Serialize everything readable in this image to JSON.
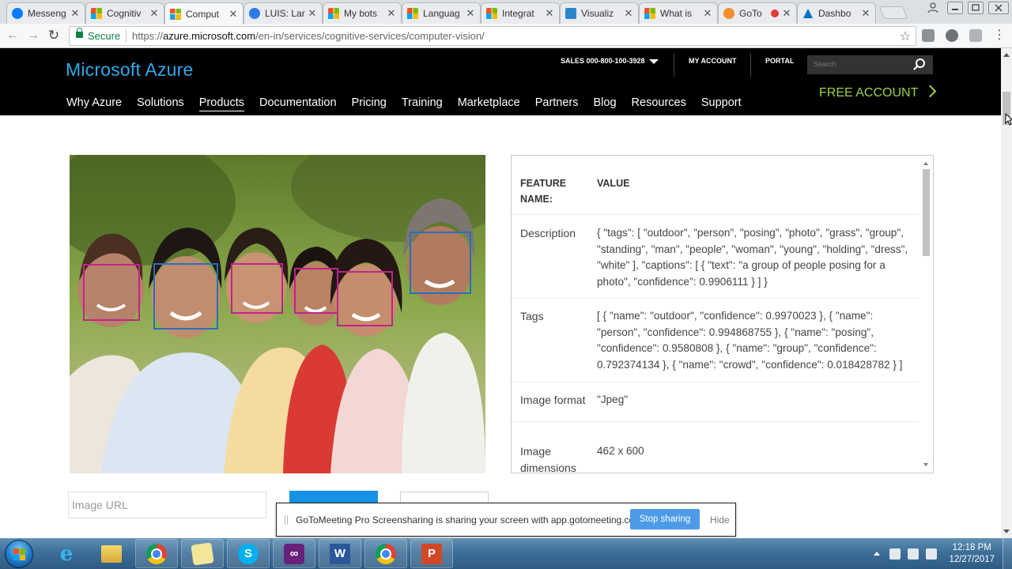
{
  "browser": {
    "tabs": [
      {
        "label": "Messeng",
        "icon": "messenger-icon"
      },
      {
        "label": "Cognitiv",
        "icon": "microsoft-icon"
      },
      {
        "label": "Comput",
        "icon": "microsoft-icon",
        "active": true
      },
      {
        "label": "LUIS: Lar",
        "icon": "luis-icon"
      },
      {
        "label": "My bots",
        "icon": "microsoft-icon"
      },
      {
        "label": "Languag",
        "icon": "microsoft-icon"
      },
      {
        "label": "Integrat",
        "icon": "microsoft-icon"
      },
      {
        "label": "Visualiz",
        "icon": "visualize-icon"
      },
      {
        "label": "What is",
        "icon": "microsoft-icon"
      },
      {
        "label": "GoTo",
        "icon": "gotomeeting-icon",
        "recording": true
      },
      {
        "label": "Dashbo",
        "icon": "azure-icon"
      }
    ],
    "secure_label": "Secure",
    "url_scheme": "https://",
    "url_domain": "azure.microsoft.com",
    "url_path": "/en-in/services/cognitive-services/computer-vision/"
  },
  "azure": {
    "brand": "Microsoft Azure",
    "sales": "SALES 000-800-100-3928",
    "my_account": "MY ACCOUNT",
    "portal": "PORTAL",
    "search_placeholder": "Search",
    "nav": [
      "Why Azure",
      "Solutions",
      "Products",
      "Documentation",
      "Pricing",
      "Training",
      "Marketplace",
      "Partners",
      "Blog",
      "Resources",
      "Support"
    ],
    "active_nav": "Products",
    "free_account": "FREE ACCOUNT"
  },
  "results": {
    "col_feature": "FEATURE",
    "col_feature_2": "NAME:",
    "col_value": "VALUE",
    "rows": [
      {
        "name": "Description",
        "value": "{ \"tags\": [ \"outdoor\", \"person\", \"posing\", \"photo\", \"grass\", \"group\", \"standing\", \"man\", \"people\", \"woman\", \"young\", \"holding\", \"dress\", \"white\" ], \"captions\": [ { \"text\": \"a group of people posing for a photo\", \"confidence\": 0.9906111 } ] }"
      },
      {
        "name": "Tags",
        "value": "[ { \"name\": \"outdoor\", \"confidence\": 0.9970023 }, { \"name\": \"person\", \"confidence\": 0.994868755 }, { \"name\": \"posing\", \"confidence\": 0.9580808 }, { \"name\": \"group\", \"confidence\": 0.792374134 }, { \"name\": \"crowd\", \"confidence\": 0.018428782 } ]"
      },
      {
        "name": "Image format",
        "value": "\"Jpeg\""
      },
      {
        "name": "Image dimensions",
        "value": "462 x 600"
      }
    ]
  },
  "form": {
    "image_url_placeholder": "Image URL"
  },
  "share_banner": {
    "message": "GoToMeeting Pro Screensharing is sharing your screen with app.gotomeeting.com.",
    "stop": "Stop sharing",
    "hide": "Hide"
  },
  "taskbar": {
    "time": "12:18 PM",
    "date": "12/27/2017",
    "apps": [
      "internet-explorer-icon",
      "file-explorer-icon",
      "chrome-icon",
      "sticky-notes-icon",
      "skype-icon",
      "visual-studio-icon",
      "word-icon",
      "chrome-icon",
      "powerpoint-icon"
    ]
  },
  "colors": {
    "azure_blue": "#2fa8e6",
    "free_account_green": "#9bd24a",
    "face_box_magenta": "#c1238a",
    "face_box_blue": "#2a6fbc",
    "stop_button": "#4d9be8"
  }
}
